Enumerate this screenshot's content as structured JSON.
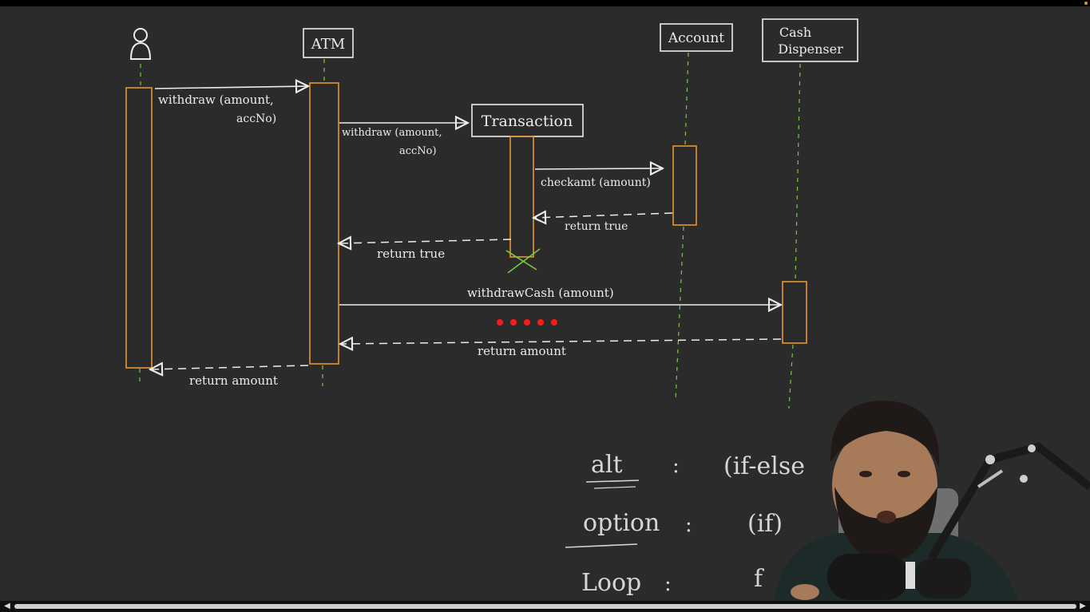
{
  "lifelines": {
    "atm": "ATM",
    "account": "Account",
    "cash_dispenser_line1": "Cash",
    "cash_dispenser_line2": "Dispenser",
    "transaction": "Transaction"
  },
  "messages": {
    "m1_line1": "withdraw (amount,",
    "m1_line2": "accNo)",
    "m2_line1": "withdraw (amount,",
    "m2_line2": "accNo)",
    "m3": "checkamt (amount)",
    "m4": "return true",
    "m5": "return true",
    "m6": "withdrawCash (amount)",
    "m7": "return amount",
    "m8": "return amount"
  },
  "notes": {
    "alt_label": "alt",
    "alt_colon": ":",
    "alt_value": "(if-else",
    "option_label": "option",
    "option_colon": ":",
    "option_value": "(if)",
    "loop_label": "Loop",
    "loop_colon": ":",
    "loop_value": "f"
  },
  "colors": {
    "background": "#2b2b2b",
    "activation": "#e8952f",
    "lifeline": "#7ac943",
    "chalk": "#ececec",
    "destroy": "#7ac943",
    "dots": "#ff1a1a"
  }
}
